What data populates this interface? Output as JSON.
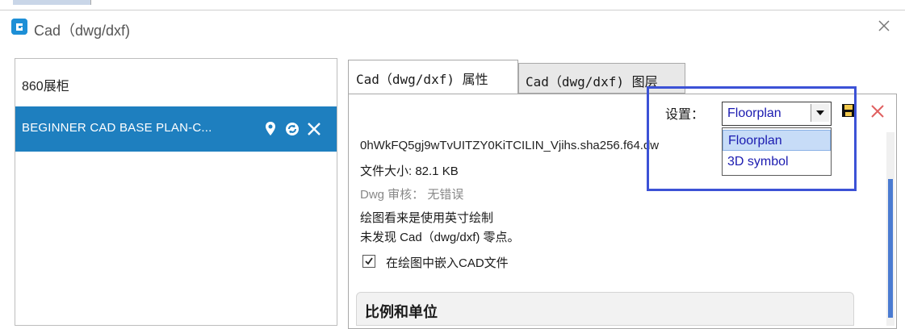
{
  "window": {
    "title": "Cad（dwg/dxf)"
  },
  "sidebar": {
    "items": [
      {
        "label": "860展柜"
      },
      {
        "label": "BEGINNER CAD BASE PLAN-C...",
        "selected": true
      }
    ]
  },
  "tabs": [
    {
      "label": "Cad（dwg/dxf) 属性",
      "active": true
    },
    {
      "label": "Cad（dwg/dxf) 图层",
      "active": false
    }
  ],
  "properties": {
    "hash": "0hWkFQ5gj9wTvUITZY0KiTCILIN_Vjihs.sha256.f64.dw",
    "file_size": "文件大小: 82.1 KB",
    "audit": "Dwg 审核： 无错误",
    "units_note": "绘图看来是使用英寸绘制",
    "zero_note": "未发现 Cad（dwg/dxf) 零点。",
    "embed_label": "在绘图中嵌入CAD文件",
    "embed_checked": true
  },
  "settings": {
    "label": "设置：",
    "selected": "Floorplan",
    "options": [
      "Floorplan",
      "3D symbol"
    ]
  },
  "section": {
    "title": "比例和单位"
  },
  "colors": {
    "accent": "#1e7fbf",
    "highlight": "#3c52d6",
    "link": "#1b1bb0"
  }
}
